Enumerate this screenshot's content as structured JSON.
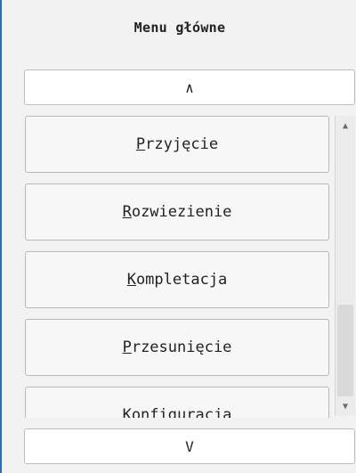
{
  "header": {
    "title": "Menu główne"
  },
  "nav": {
    "up_label": "∧",
    "down_label": "V"
  },
  "menu": {
    "items": [
      {
        "mnemonic": "P",
        "rest": "rzyjęcie"
      },
      {
        "mnemonic": "R",
        "rest": "ozwiezienie"
      },
      {
        "mnemonic": "K",
        "rest": "ompletacja"
      },
      {
        "mnemonic": "P",
        "rest": "rzesunięcie"
      },
      {
        "mnemonic": "",
        "rest": "Konfiguracja"
      }
    ]
  },
  "scrollbar": {
    "up_icon": "▲",
    "down_icon": "▼",
    "position_fraction": 1.0
  }
}
